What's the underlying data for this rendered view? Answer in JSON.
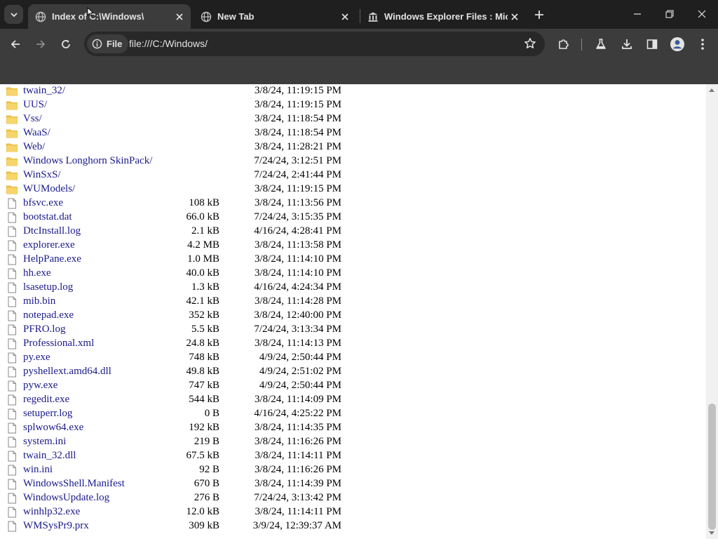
{
  "tabs": [
    {
      "title": "Index of C:\\Windows\\",
      "active": true,
      "icon": "globe-icon"
    },
    {
      "title": "New Tab",
      "active": false,
      "icon": "globe-icon"
    },
    {
      "title": "Windows Explorer Files : Micro",
      "active": false,
      "icon": "archive-icon"
    }
  ],
  "omnibox": {
    "chip_label": "File",
    "url": "file:///C:/Windows/"
  },
  "theme": {
    "chrome_dark": "#1f1f1f",
    "toolbar": "#3c3c3c",
    "link_color": "#1a1a8c",
    "folder_color": "#f2c84b"
  },
  "listing": [
    {
      "type": "folder",
      "name": "twain_32/",
      "size": "",
      "date": "3/8/24, 11:19:15 PM"
    },
    {
      "type": "folder",
      "name": "UUS/",
      "size": "",
      "date": "3/8/24, 11:19:15 PM"
    },
    {
      "type": "folder",
      "name": "Vss/",
      "size": "",
      "date": "3/8/24, 11:18:54 PM"
    },
    {
      "type": "folder",
      "name": "WaaS/",
      "size": "",
      "date": "3/8/24, 11:18:54 PM"
    },
    {
      "type": "folder",
      "name": "Web/",
      "size": "",
      "date": "3/8/24, 11:28:21 PM"
    },
    {
      "type": "folder",
      "name": "Windows Longhorn SkinPack/",
      "size": "",
      "date": "7/24/24, 3:12:51 PM"
    },
    {
      "type": "folder",
      "name": "WinSxS/",
      "size": "",
      "date": "7/24/24, 2:41:44 PM"
    },
    {
      "type": "folder",
      "name": "WUModels/",
      "size": "",
      "date": "3/8/24, 11:19:15 PM"
    },
    {
      "type": "file",
      "name": "bfsvc.exe",
      "size": "108 kB",
      "date": "3/8/24, 11:13:56 PM"
    },
    {
      "type": "file",
      "name": "bootstat.dat",
      "size": "66.0 kB",
      "date": "7/24/24, 3:15:35 PM"
    },
    {
      "type": "file",
      "name": "DtcInstall.log",
      "size": "2.1 kB",
      "date": "4/16/24, 4:28:41 PM"
    },
    {
      "type": "file",
      "name": "explorer.exe",
      "size": "4.2 MB",
      "date": "3/8/24, 11:13:58 PM"
    },
    {
      "type": "file",
      "name": "HelpPane.exe",
      "size": "1.0 MB",
      "date": "3/8/24, 11:14:10 PM"
    },
    {
      "type": "file",
      "name": "hh.exe",
      "size": "40.0 kB",
      "date": "3/8/24, 11:14:10 PM"
    },
    {
      "type": "file",
      "name": "lsasetup.log",
      "size": "1.3 kB",
      "date": "4/16/24, 4:24:34 PM"
    },
    {
      "type": "file",
      "name": "mib.bin",
      "size": "42.1 kB",
      "date": "3/8/24, 11:14:28 PM"
    },
    {
      "type": "file",
      "name": "notepad.exe",
      "size": "352 kB",
      "date": "3/8/24, 12:40:00 PM"
    },
    {
      "type": "file",
      "name": "PFRO.log",
      "size": "5.5 kB",
      "date": "7/24/24, 3:13:34 PM"
    },
    {
      "type": "file",
      "name": "Professional.xml",
      "size": "24.8 kB",
      "date": "3/8/24, 11:14:13 PM"
    },
    {
      "type": "file",
      "name": "py.exe",
      "size": "748 kB",
      "date": "4/9/24, 2:50:44 PM"
    },
    {
      "type": "file",
      "name": "pyshellext.amd64.dll",
      "size": "49.8 kB",
      "date": "4/9/24, 2:51:02 PM"
    },
    {
      "type": "file",
      "name": "pyw.exe",
      "size": "747 kB",
      "date": "4/9/24, 2:50:44 PM"
    },
    {
      "type": "file",
      "name": "regedit.exe",
      "size": "544 kB",
      "date": "3/8/24, 11:14:09 PM"
    },
    {
      "type": "file",
      "name": "setuperr.log",
      "size": "0 B",
      "date": "4/16/24, 4:25:22 PM"
    },
    {
      "type": "file",
      "name": "splwow64.exe",
      "size": "192 kB",
      "date": "3/8/24, 11:14:35 PM"
    },
    {
      "type": "file",
      "name": "system.ini",
      "size": "219 B",
      "date": "3/8/24, 11:16:26 PM"
    },
    {
      "type": "file",
      "name": "twain_32.dll",
      "size": "67.5 kB",
      "date": "3/8/24, 11:14:11 PM"
    },
    {
      "type": "file",
      "name": "win.ini",
      "size": "92 B",
      "date": "3/8/24, 11:16:26 PM"
    },
    {
      "type": "file",
      "name": "WindowsShell.Manifest",
      "size": "670 B",
      "date": "3/8/24, 11:14:39 PM"
    },
    {
      "type": "file",
      "name": "WindowsUpdate.log",
      "size": "276 B",
      "date": "7/24/24, 3:13:42 PM"
    },
    {
      "type": "file",
      "name": "winhlp32.exe",
      "size": "12.0 kB",
      "date": "3/8/24, 11:14:11 PM"
    },
    {
      "type": "file",
      "name": "WMSysPr9.prx",
      "size": "309 kB",
      "date": "3/9/24, 12:39:37 AM"
    }
  ]
}
